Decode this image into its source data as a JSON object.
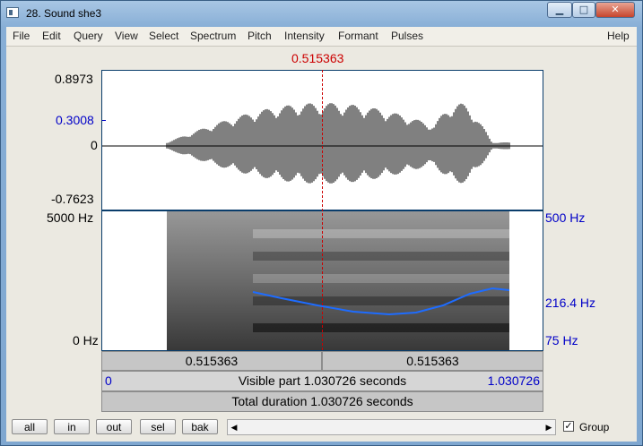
{
  "window": {
    "title": "28. Sound she3",
    "minimize_icon": "minimize-icon",
    "maximize_icon": "maximize-icon",
    "close_icon": "close-icon"
  },
  "menu": [
    "File",
    "Edit",
    "Query",
    "View",
    "Select",
    "Spectrum",
    "Pitch",
    "Intensity",
    "Formant",
    "Pulses",
    "Help"
  ],
  "cursor": {
    "time": "0.515363"
  },
  "waveform": {
    "max": "0.8973",
    "marker": "0.3008",
    "zero": "0",
    "min": "-0.7623"
  },
  "spectrogram": {
    "top_left": "5000 Hz",
    "bottom_left": "0 Hz",
    "top_right": "500 Hz",
    "mid_right": "216.4 Hz",
    "bottom_right": "75 Hz"
  },
  "colors": {
    "pitch": "#1e6cff",
    "cursor": "#cc0000",
    "labels_blue": "#0000c8"
  },
  "bars": {
    "left_time": "0.515363",
    "right_time": "0.515363",
    "visible_start": "0",
    "visible_text": "Visible part 1.030726 seconds",
    "visible_end": "1.030726",
    "total_text": "Total duration 1.030726 seconds"
  },
  "buttons": [
    "all",
    "in",
    "out",
    "sel",
    "bak"
  ],
  "group": {
    "label": "Group",
    "checked": true
  }
}
